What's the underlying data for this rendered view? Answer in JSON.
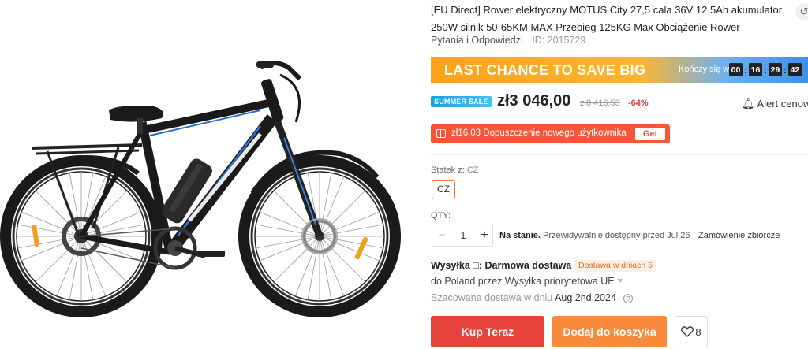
{
  "product": {
    "title": "[EU Direct] Rower elektryczny MOTUS City 27,5 cala 36V 12,5Ah akumulator 250W silnik 50-65KM MAX Przebieg 125KG Max Obciążenie Rower",
    "qa_link": "Pytania i Odpowiedzi",
    "id_text": "ID: 2015729",
    "share_icon": "share-icon"
  },
  "promo": {
    "banner_text": "LAST CHANCE TO SAVE BIG",
    "ends_in_label": "Kończy się w",
    "timer": {
      "hours": "00",
      "minutes": "16",
      "seconds": "29",
      "centis": "42"
    },
    "colors": {
      "orange": "#ffa21a",
      "blue": "#3f8fe6"
    }
  },
  "pricing": {
    "sale_badge": "SUMMER SALE",
    "price": "zł3 046,00",
    "old_price": "zł8 416,53",
    "discount": "-64%",
    "alert_label": "Alert cenowy"
  },
  "coupon": {
    "text": "zł16,03 Dopuszczenie nowego użytkownika",
    "button": "Get",
    "color": "#f7553a"
  },
  "options": {
    "ship_from_label": "Statek z:",
    "ship_from_value": "CZ",
    "selected": "CZ",
    "accent": "#f0793f"
  },
  "quantity": {
    "label": "QTY:",
    "minus": "−",
    "value": "1",
    "plus": "+",
    "stock_bold": "Na stanie.",
    "stock_text": "Przewidywalnie dostępny przed Jul 26",
    "bulk_link": "Zamówienie zbiorcze"
  },
  "shipping": {
    "label": "Wysyłka",
    "label_icon": "□:",
    "method": "Darmowa dostawa",
    "badge": "Dostawa w dniach 5",
    "to_text": "do Poland przez Wysyłka priorytetowa UE",
    "eta_label": "Szacowana dostawa w dniu",
    "eta_date": "Aug 2nd,2024",
    "help": "?"
  },
  "actions": {
    "buy_now": "Kup Teraz",
    "add_to_cart": "Dodaj do koszyka",
    "wishlist_count": "8",
    "buy_color": "#e5433b",
    "cart_color": "#f98a3c"
  }
}
